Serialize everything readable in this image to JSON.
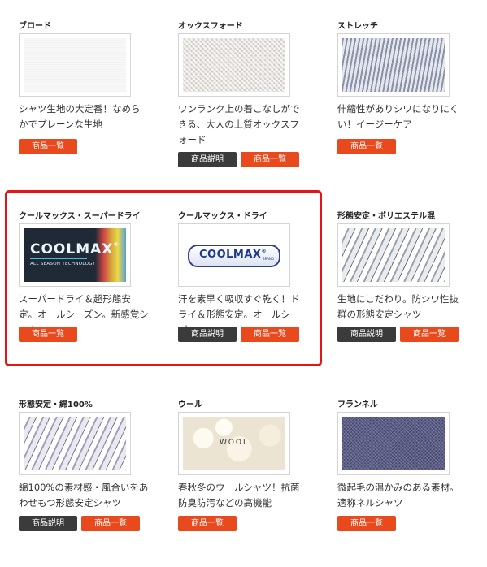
{
  "colors": {
    "button_primary": "#e8491d",
    "button_secondary": "#3b3b3b",
    "highlight_border": "#e61414"
  },
  "products": [
    {
      "title": "ブロード",
      "desc": "シャツ生地の大定番！なめらかでプレーンな生地",
      "image_icon": "fabric-broadcloth-image",
      "buttons": [
        "商品一覧"
      ]
    },
    {
      "title": "オックスフォード",
      "desc": "ワンランク上の着こなしができる、大人の上質オックスフォード",
      "image_icon": "fabric-oxford-image",
      "buttons": [
        "商品説明",
        "商品一覧"
      ]
    },
    {
      "title": "ストレッチ",
      "desc": "伸縮性がありシワになりにくい！イージーケア",
      "image_icon": "fabric-stretch-image",
      "buttons": [
        "商品一覧"
      ]
    },
    {
      "title": "クールマックス・スーパードライ",
      "desc": "スーパードライ＆超形態安定。オールシーズン。新感覚シャツ",
      "image_icon": "coolmax-logo-image",
      "logo_text": {
        "word": "COOLMAX",
        "reg": "®",
        "sub": "ALL SEASON TECHNOLOGY"
      },
      "buttons": [
        "商品一覧"
      ]
    },
    {
      "title": "クールマックス・ドライ",
      "desc": "汗を素早く吸収すぐ乾く！ドライ＆形態安定。オールシーズン",
      "image_icon": "coolmax-brand-logo-image",
      "logo_text": {
        "word": "COOLMAX",
        "reg": "®",
        "brand": "BRAND"
      },
      "buttons": [
        "商品説明",
        "商品一覧"
      ]
    },
    {
      "title": "形態安定・ポリエステル混",
      "desc": "生地にこだわり。防シワ性抜群の形態安定シャツ",
      "image_icon": "shirts-stack-image",
      "buttons": [
        "商品説明",
        "商品一覧"
      ]
    },
    {
      "title": "形態安定・綿100%",
      "desc": "綿100%の素材感・風合いをあわせもつ形態安定シャツ",
      "image_icon": "cotton-shirts-image",
      "buttons": [
        "商品説明",
        "商品一覧"
      ]
    },
    {
      "title": "ウール",
      "desc": "春秋冬のウールシャツ！抗菌防臭防汚などの高機能",
      "image_icon": "wool-image",
      "image_label": "WOOL",
      "buttons": [
        "商品一覧"
      ]
    },
    {
      "title": "フランネル",
      "desc": "微起毛の温かみのある素材。適称ネルシャツ",
      "image_icon": "flannel-fabric-image",
      "buttons": [
        "商品一覧"
      ]
    }
  ]
}
